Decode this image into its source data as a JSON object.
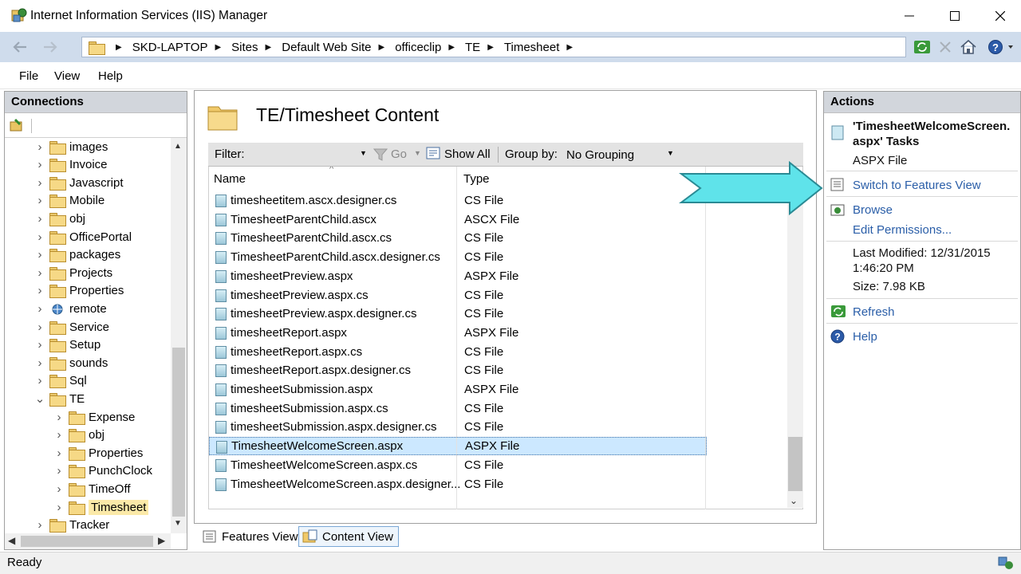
{
  "window": {
    "title": "Internet Information Services (IIS) Manager"
  },
  "address": {
    "crumbs": [
      "SKD-LAPTOP",
      "Sites",
      "Default Web Site",
      "officeclip",
      "TE",
      "Timesheet"
    ]
  },
  "menu": {
    "items": [
      "File",
      "View",
      "Help"
    ]
  },
  "connections": {
    "header": "Connections",
    "tree": [
      {
        "label": "images",
        "icon": "folder-icon"
      },
      {
        "label": "Invoice",
        "icon": "folder-icon"
      },
      {
        "label": "Javascript",
        "icon": "folder-icon"
      },
      {
        "label": "Mobile",
        "icon": "folder-icon"
      },
      {
        "label": "obj",
        "icon": "folder-icon"
      },
      {
        "label": "OfficePortal",
        "icon": "folder-icon"
      },
      {
        "label": "packages",
        "icon": "folder-icon"
      },
      {
        "label": "Projects",
        "icon": "folder-icon"
      },
      {
        "label": "Properties",
        "icon": "folder-icon"
      },
      {
        "label": "remote",
        "icon": "virtual-directory-icon"
      },
      {
        "label": "Service",
        "icon": "folder-icon"
      },
      {
        "label": "Setup",
        "icon": "folder-icon"
      },
      {
        "label": "sounds",
        "icon": "folder-icon"
      },
      {
        "label": "Sql",
        "icon": "folder-icon"
      },
      {
        "label": "TE",
        "icon": "folder-icon",
        "expanded": true
      },
      {
        "label": "Expense",
        "icon": "folder-icon",
        "child": true
      },
      {
        "label": "obj",
        "icon": "folder-icon",
        "child": true
      },
      {
        "label": "Properties",
        "icon": "folder-icon",
        "child": true
      },
      {
        "label": "PunchClock",
        "icon": "folder-icon",
        "child": true
      },
      {
        "label": "TimeOff",
        "icon": "folder-icon",
        "child": true
      },
      {
        "label": "Timesheet",
        "icon": "folder-icon",
        "child": true,
        "selected": true
      },
      {
        "label": "Tracker",
        "icon": "folder-icon"
      }
    ]
  },
  "content": {
    "title": "TE/Timesheet Content",
    "filter_label": "Filter:",
    "filter_value": "",
    "go_label": "Go",
    "show_all_label": "Show All",
    "group_by_label": "Group by:",
    "group_by_value": "No Grouping",
    "columns": [
      "Name",
      "Type"
    ],
    "rows": [
      {
        "name": "timesheetitem.ascx.designer.cs",
        "type": "CS File"
      },
      {
        "name": "TimesheetParentChild.ascx",
        "type": "ASCX File"
      },
      {
        "name": "TimesheetParentChild.ascx.cs",
        "type": "CS File"
      },
      {
        "name": "TimesheetParentChild.ascx.designer.cs",
        "type": "CS File"
      },
      {
        "name": "timesheetPreview.aspx",
        "type": "ASPX File"
      },
      {
        "name": "timesheetPreview.aspx.cs",
        "type": "CS File"
      },
      {
        "name": "timesheetPreview.aspx.designer.cs",
        "type": "CS File"
      },
      {
        "name": "timesheetReport.aspx",
        "type": "ASPX File"
      },
      {
        "name": "timesheetReport.aspx.cs",
        "type": "CS File"
      },
      {
        "name": "timesheetReport.aspx.designer.cs",
        "type": "CS File"
      },
      {
        "name": "timesheetSubmission.aspx",
        "type": "ASPX File"
      },
      {
        "name": "timesheetSubmission.aspx.cs",
        "type": "CS File"
      },
      {
        "name": "timesheetSubmission.aspx.designer.cs",
        "type": "CS File"
      },
      {
        "name": "TimesheetWelcomeScreen.aspx",
        "type": "ASPX File",
        "selected": true
      },
      {
        "name": "TimesheetWelcomeScreen.aspx.cs",
        "type": "CS File"
      },
      {
        "name": "TimesheetWelcomeScreen.aspx.designer...",
        "type": "CS File"
      }
    ],
    "tabs": [
      "Features View",
      "Content View"
    ],
    "active_tab": "Content View"
  },
  "actions": {
    "header": "Actions",
    "task_title_1": "'TimesheetWelcomeScreen.",
    "task_title_2": "aspx' Tasks",
    "file_type": "ASPX File",
    "switch_features": "Switch to Features View",
    "browse": "Browse",
    "edit_permissions": "Edit Permissions...",
    "last_modified_1": "Last Modified: 12/31/2015",
    "last_modified_2": "1:46:20 PM",
    "size": "Size: 7.98 KB",
    "refresh": "Refresh",
    "help": "Help"
  },
  "status": {
    "text": "Ready"
  },
  "colors": {
    "accent_link": "#2a5ea8",
    "callout_arrow": "#5fe3ea",
    "selection": "#cce8ff"
  }
}
